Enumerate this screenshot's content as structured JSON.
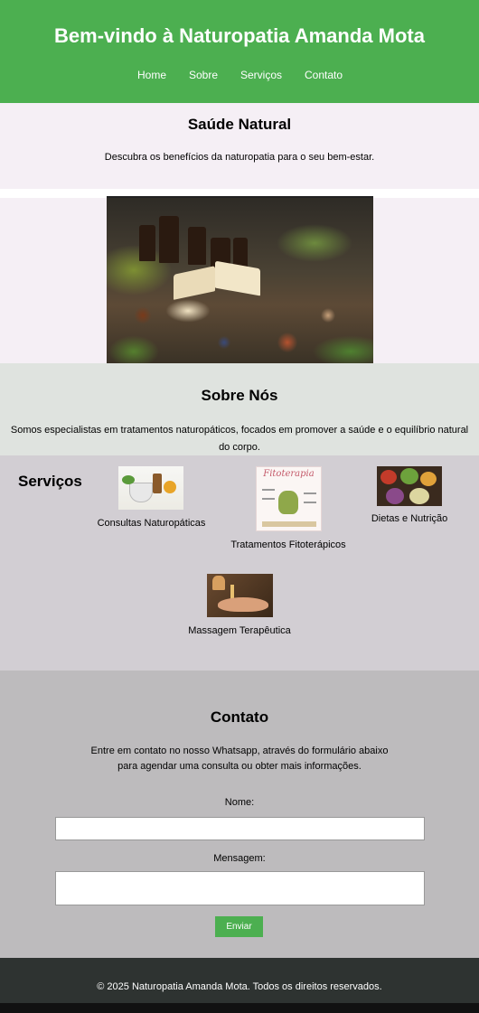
{
  "header": {
    "title": "Bem-vindo à Naturopatia Amanda Mota",
    "nav": [
      "Home",
      "Sobre",
      "Serviços",
      "Contato"
    ]
  },
  "hero": {
    "title": "Saúde Natural",
    "subtitle": "Descubra os benefícios da naturopatia para o seu bem-estar."
  },
  "about": {
    "title": "Sobre Nós",
    "text": "Somos especialistas em tratamentos naturopáticos, focados em promover a saúde e o equilíbrio natural do corpo."
  },
  "services": {
    "title": "Serviços",
    "items": [
      {
        "label": "Consultas Naturopáticas",
        "icon": "herbal-mortar-image"
      },
      {
        "label": "Tratamentos Fitoterápicos",
        "icon": "fitoterapia-poster-image",
        "poster_text": "Fitoterapia"
      },
      {
        "label": "Dietas e Nutrição",
        "icon": "healthy-food-bowls-image"
      },
      {
        "label": "Massagem Terapêutica",
        "icon": "massage-oil-hands-image"
      }
    ]
  },
  "contact": {
    "title": "Contato",
    "text": "Entre em contato no nosso Whatsapp, através do formulário abaixo para agendar uma consulta ou obter mais informações.",
    "name_label": "Nome:",
    "name_value": "",
    "message_label": "Mensagem:",
    "message_value": "",
    "submit_label": "Enviar"
  },
  "footer": {
    "text": "© 2025 Naturopatia Amanda Mota. Todos os direitos reservados."
  },
  "colors": {
    "header_green": "#4caf50",
    "button_green": "#4caf50",
    "footer_dark": "#2e3331"
  }
}
